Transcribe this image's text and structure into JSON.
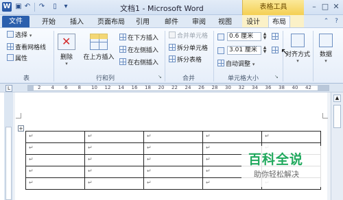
{
  "titlebar": {
    "doc_title": "文档1 - Microsoft Word",
    "context_label": "表格工具",
    "app_icon_letter": "W",
    "quick_access": [
      "save-icon",
      "undo-icon",
      "redo-icon",
      "new-icon",
      "customize-icon"
    ],
    "window_controls": [
      "minimize-icon",
      "maximize-icon",
      "close-icon"
    ]
  },
  "tabs": {
    "file": "文件",
    "items": [
      "开始",
      "插入",
      "页面布局",
      "引用",
      "邮件",
      "审阅",
      "视图",
      "设计",
      "布局"
    ],
    "active": "布局"
  },
  "ribbon": {
    "groups": {
      "table": {
        "label": "表",
        "select": "选择",
        "view_gridlines": "查看网格线",
        "properties": "属性"
      },
      "rows_cols": {
        "label": "行和列",
        "delete": "删除",
        "insert_above": "在上方插入",
        "insert_below": "在下方插入",
        "insert_left": "在左侧插入",
        "insert_right": "在右侧插入"
      },
      "merge": {
        "label": "合并",
        "merge_cells": "合并单元格",
        "split_cells": "拆分单元格",
        "split_table": "拆分表格"
      },
      "cell_size": {
        "label": "单元格大小",
        "height_value": "0.6 厘米",
        "width_value": "3.01 厘米",
        "autofit": "自动调整"
      },
      "alignment": {
        "label": "对齐方式"
      },
      "data": {
        "label": "数据"
      }
    }
  },
  "ruler": {
    "numbers": [
      "2",
      "4",
      "6",
      "8",
      "10",
      "12",
      "14",
      "16",
      "18",
      "20",
      "22",
      "24",
      "26",
      "28",
      "30",
      "32",
      "34",
      "36",
      "38",
      "40",
      "42"
    ]
  },
  "table": {
    "cell_mark": "↵",
    "rows": 5,
    "cols": 5
  },
  "watermark": {
    "title": "百科全说",
    "subtitle": "助你轻松解决"
  },
  "colors": {
    "file_tab": "#2b5fad",
    "context_tab": "#f4cf53",
    "watermark_green": "#20a95d"
  }
}
